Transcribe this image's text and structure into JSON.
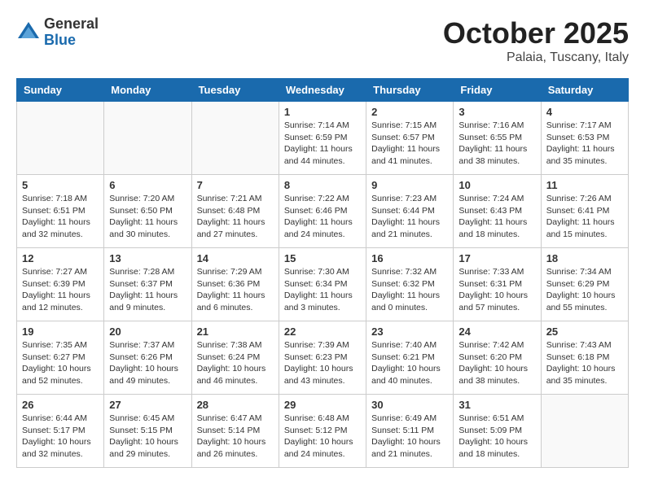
{
  "header": {
    "logo_general": "General",
    "logo_blue": "Blue",
    "month_title": "October 2025",
    "location": "Palaia, Tuscany, Italy"
  },
  "days_of_week": [
    "Sunday",
    "Monday",
    "Tuesday",
    "Wednesday",
    "Thursday",
    "Friday",
    "Saturday"
  ],
  "weeks": [
    [
      {
        "day": "",
        "info": ""
      },
      {
        "day": "",
        "info": ""
      },
      {
        "day": "",
        "info": ""
      },
      {
        "day": "1",
        "info": "Sunrise: 7:14 AM\nSunset: 6:59 PM\nDaylight: 11 hours and 44 minutes."
      },
      {
        "day": "2",
        "info": "Sunrise: 7:15 AM\nSunset: 6:57 PM\nDaylight: 11 hours and 41 minutes."
      },
      {
        "day": "3",
        "info": "Sunrise: 7:16 AM\nSunset: 6:55 PM\nDaylight: 11 hours and 38 minutes."
      },
      {
        "day": "4",
        "info": "Sunrise: 7:17 AM\nSunset: 6:53 PM\nDaylight: 11 hours and 35 minutes."
      }
    ],
    [
      {
        "day": "5",
        "info": "Sunrise: 7:18 AM\nSunset: 6:51 PM\nDaylight: 11 hours and 32 minutes."
      },
      {
        "day": "6",
        "info": "Sunrise: 7:20 AM\nSunset: 6:50 PM\nDaylight: 11 hours and 30 minutes."
      },
      {
        "day": "7",
        "info": "Sunrise: 7:21 AM\nSunset: 6:48 PM\nDaylight: 11 hours and 27 minutes."
      },
      {
        "day": "8",
        "info": "Sunrise: 7:22 AM\nSunset: 6:46 PM\nDaylight: 11 hours and 24 minutes."
      },
      {
        "day": "9",
        "info": "Sunrise: 7:23 AM\nSunset: 6:44 PM\nDaylight: 11 hours and 21 minutes."
      },
      {
        "day": "10",
        "info": "Sunrise: 7:24 AM\nSunset: 6:43 PM\nDaylight: 11 hours and 18 minutes."
      },
      {
        "day": "11",
        "info": "Sunrise: 7:26 AM\nSunset: 6:41 PM\nDaylight: 11 hours and 15 minutes."
      }
    ],
    [
      {
        "day": "12",
        "info": "Sunrise: 7:27 AM\nSunset: 6:39 PM\nDaylight: 11 hours and 12 minutes."
      },
      {
        "day": "13",
        "info": "Sunrise: 7:28 AM\nSunset: 6:37 PM\nDaylight: 11 hours and 9 minutes."
      },
      {
        "day": "14",
        "info": "Sunrise: 7:29 AM\nSunset: 6:36 PM\nDaylight: 11 hours and 6 minutes."
      },
      {
        "day": "15",
        "info": "Sunrise: 7:30 AM\nSunset: 6:34 PM\nDaylight: 11 hours and 3 minutes."
      },
      {
        "day": "16",
        "info": "Sunrise: 7:32 AM\nSunset: 6:32 PM\nDaylight: 11 hours and 0 minutes."
      },
      {
        "day": "17",
        "info": "Sunrise: 7:33 AM\nSunset: 6:31 PM\nDaylight: 10 hours and 57 minutes."
      },
      {
        "day": "18",
        "info": "Sunrise: 7:34 AM\nSunset: 6:29 PM\nDaylight: 10 hours and 55 minutes."
      }
    ],
    [
      {
        "day": "19",
        "info": "Sunrise: 7:35 AM\nSunset: 6:27 PM\nDaylight: 10 hours and 52 minutes."
      },
      {
        "day": "20",
        "info": "Sunrise: 7:37 AM\nSunset: 6:26 PM\nDaylight: 10 hours and 49 minutes."
      },
      {
        "day": "21",
        "info": "Sunrise: 7:38 AM\nSunset: 6:24 PM\nDaylight: 10 hours and 46 minutes."
      },
      {
        "day": "22",
        "info": "Sunrise: 7:39 AM\nSunset: 6:23 PM\nDaylight: 10 hours and 43 minutes."
      },
      {
        "day": "23",
        "info": "Sunrise: 7:40 AM\nSunset: 6:21 PM\nDaylight: 10 hours and 40 minutes."
      },
      {
        "day": "24",
        "info": "Sunrise: 7:42 AM\nSunset: 6:20 PM\nDaylight: 10 hours and 38 minutes."
      },
      {
        "day": "25",
        "info": "Sunrise: 7:43 AM\nSunset: 6:18 PM\nDaylight: 10 hours and 35 minutes."
      }
    ],
    [
      {
        "day": "26",
        "info": "Sunrise: 6:44 AM\nSunset: 5:17 PM\nDaylight: 10 hours and 32 minutes."
      },
      {
        "day": "27",
        "info": "Sunrise: 6:45 AM\nSunset: 5:15 PM\nDaylight: 10 hours and 29 minutes."
      },
      {
        "day": "28",
        "info": "Sunrise: 6:47 AM\nSunset: 5:14 PM\nDaylight: 10 hours and 26 minutes."
      },
      {
        "day": "29",
        "info": "Sunrise: 6:48 AM\nSunset: 5:12 PM\nDaylight: 10 hours and 24 minutes."
      },
      {
        "day": "30",
        "info": "Sunrise: 6:49 AM\nSunset: 5:11 PM\nDaylight: 10 hours and 21 minutes."
      },
      {
        "day": "31",
        "info": "Sunrise: 6:51 AM\nSunset: 5:09 PM\nDaylight: 10 hours and 18 minutes."
      },
      {
        "day": "",
        "info": ""
      }
    ]
  ]
}
